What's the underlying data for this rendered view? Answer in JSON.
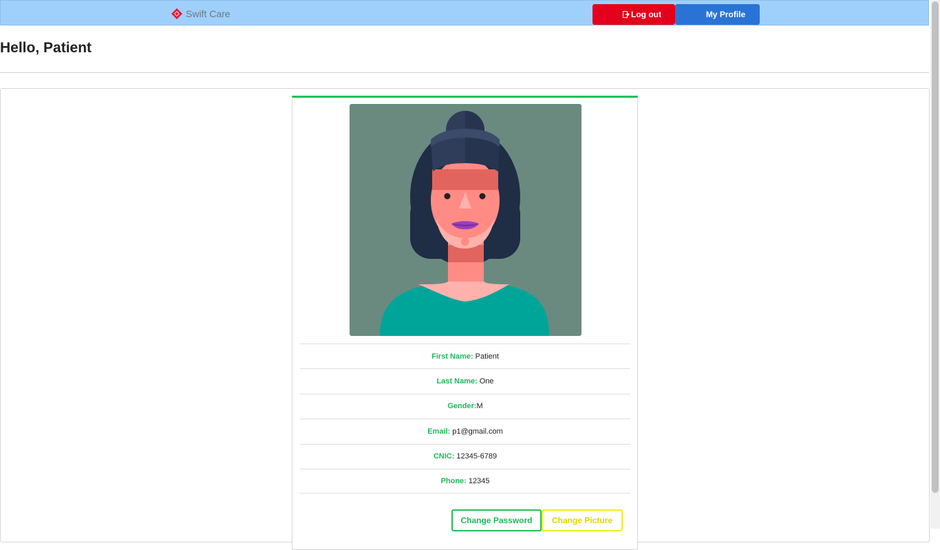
{
  "navbar": {
    "brand": "Swift Care",
    "logout_label": "Log out",
    "profile_label": "My Profile"
  },
  "header": {
    "greeting": "Hello, Patient"
  },
  "profile": {
    "fields": [
      {
        "label": "First Name:",
        "value": "Patient"
      },
      {
        "label": "Last Name:",
        "value": "One"
      },
      {
        "label": "Gender:",
        "value": "M"
      },
      {
        "label": "Email:",
        "value": "p1@gmail.com"
      },
      {
        "label": "CNIC:",
        "value": "12345-6789"
      },
      {
        "label": "Phone:",
        "value": "12345"
      }
    ],
    "actions": {
      "change_password": "Change Password",
      "change_picture": "Change Picture"
    }
  },
  "colors": {
    "navbar_bg": "#9fd0fc",
    "logout_bg": "#e4001c",
    "profile_bg": "#2a73d6",
    "accent_green": "#21c05a",
    "accent_yellow": "#f0ee1a"
  }
}
